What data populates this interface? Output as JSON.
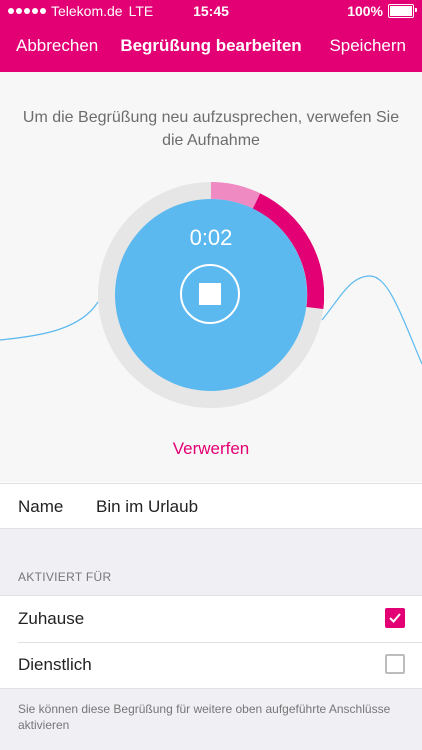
{
  "status_bar": {
    "carrier": "Telekom.de",
    "network": "LTE",
    "time": "15:45",
    "battery": "100%",
    "signal_bars": 5
  },
  "nav": {
    "cancel_label": "Abbrechen",
    "title": "Begrüßung bearbeiten",
    "save_label": "Speichern"
  },
  "recorder": {
    "instruction": "Um die Begrüßung neu aufzusprechen, verwefen Sie die Aufnahme",
    "timer": "0:02",
    "discard_label": "Verwerfen",
    "stop_icon": "stop-icon"
  },
  "name_field": {
    "label": "Name",
    "value": "Bin im Urlaub"
  },
  "activation": {
    "section_title": "AKTIVIERT FÜR",
    "options": [
      {
        "label": "Zuhause",
        "checked": true
      },
      {
        "label": "Dienstlich",
        "checked": false
      }
    ],
    "footer_note": "Sie können diese Begrüßung für weitere oben aufgeführte Anschlüsse aktivieren"
  },
  "colors": {
    "brand": "#e20074",
    "recording_circle": "#5bb9ef",
    "progress_light": "#f08ac3",
    "waveform": "#5bb9ef"
  }
}
